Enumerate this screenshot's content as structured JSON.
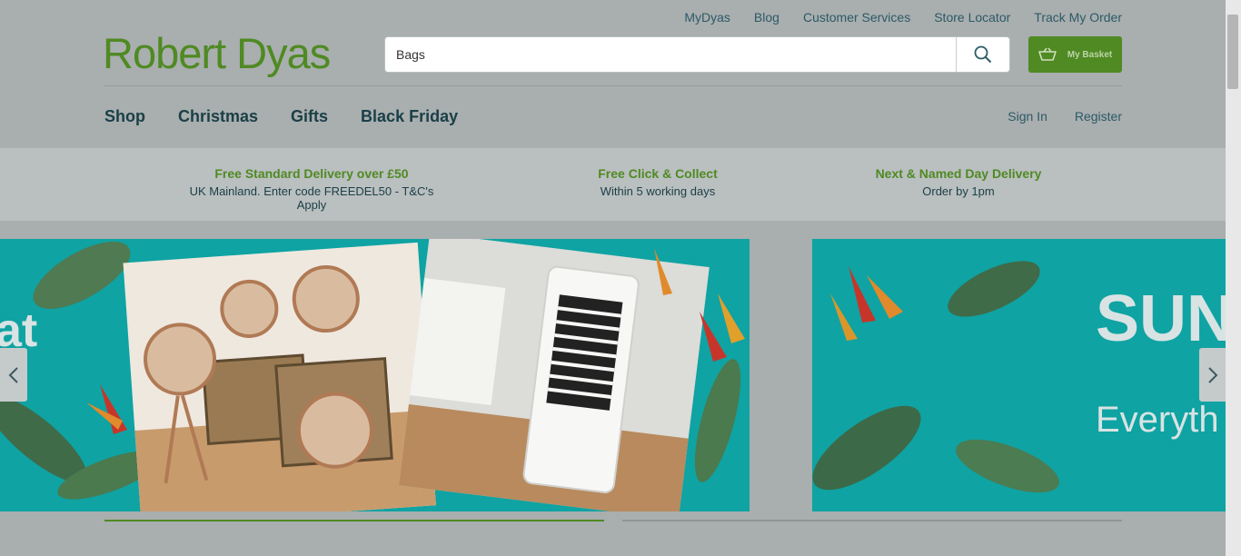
{
  "top_links": [
    "MyDyas",
    "Blog",
    "Customer Services",
    "Store Locator",
    "Track My Order"
  ],
  "logo": "Robert Dyas",
  "search": {
    "value": "Bags"
  },
  "basket": {
    "label": "My Basket"
  },
  "nav": [
    "Shop",
    "Christmas",
    "Gifts",
    "Black Friday"
  ],
  "auth": {
    "sign_in": "Sign In",
    "register": "Register"
  },
  "usps": [
    {
      "title": "Free Standard Delivery over £50",
      "sub": "UK Mainland. Enter code FREEDEL50 - T&C's Apply"
    },
    {
      "title": "Free Click & Collect",
      "sub": "Within 5 working days"
    },
    {
      "title": "Next & Named Day Delivery",
      "sub": "Order by 1pm"
    }
  ],
  "carousel": {
    "slide1": {
      "partial_text": "at"
    },
    "slide2": {
      "heading": "SUN",
      "subtext": "Everyth"
    }
  },
  "colors": {
    "brand_green": "#4f8a22",
    "teal": "#0fa3a3",
    "dark_text": "#1a3f46"
  }
}
